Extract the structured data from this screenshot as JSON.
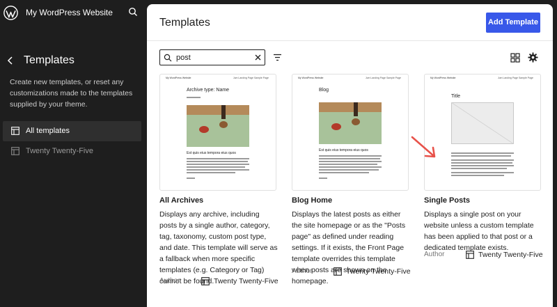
{
  "app": {
    "site_title": "My WordPress Website"
  },
  "sidebar": {
    "heading": "Templates",
    "description": "Create new templates, or reset any customizations made to the templates supplied by your theme.",
    "items": [
      {
        "label": "All templates",
        "active": true
      },
      {
        "label": "Twenty Twenty-Five",
        "active": false
      }
    ]
  },
  "header": {
    "title": "Templates",
    "add_button": "Add Template"
  },
  "toolbar": {
    "search_value": "post"
  },
  "templates": [
    {
      "title": "All Archives",
      "description": "Displays any archive, including posts by a single author, category, tag, taxonomy, custom post type, and date. This template will serve as a fallback when more specific templates (e.g. Category or Tag) cannot be found.",
      "author_label": "Author",
      "theme": "Twenty Twenty-Five",
      "preview": {
        "site": "My WordPress Website",
        "nav": "Jum Landing Page   Sample Page",
        "title": "Archive type: Name",
        "post_title": "Est quis eius tempora eius quos"
      }
    },
    {
      "title": "Blog Home",
      "description": "Displays the latest posts as either the site homepage or as the \"Posts page\" as defined under reading settings. If it exists, the Front Page template overrides this template when posts are shown on the homepage.",
      "author_label": "Author",
      "theme": "Twenty Twenty-Five",
      "preview": {
        "site": "My WordPress Website",
        "nav": "Jum Landing Page   Sample Page",
        "title": "Blog",
        "post_title": "Est quis eius tempora eius quos"
      }
    },
    {
      "title": "Single Posts",
      "description": "Displays a single post on your website unless a custom template has been applied to that post or a dedicated template exists.",
      "author_label": "Author",
      "theme": "Twenty Twenty-Five",
      "preview": {
        "site": "My WordPress Website",
        "nav": "Jum Landing Page   Sample Page",
        "title": "Title",
        "post_title": ""
      }
    }
  ],
  "colors": {
    "accent": "#3858e9",
    "sidebar_bg": "#1e1e1e",
    "arrow": "#e8524a",
    "photo_bg": "#a8c29a",
    "photo_floor": "#b48a5a"
  }
}
